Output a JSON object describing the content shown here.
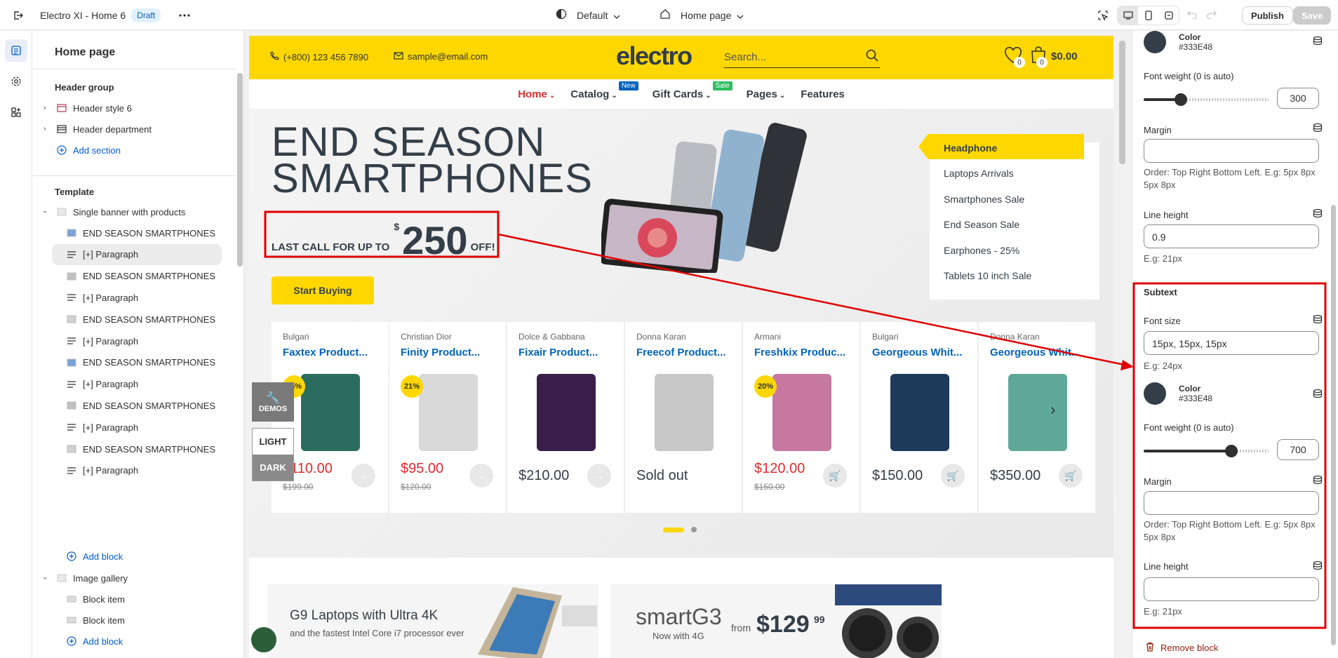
{
  "topbar": {
    "store_title": "Electro XI - Home 6",
    "status_badge": "Draft",
    "theme_label": "Default",
    "page_label": "Home page",
    "publish_label": "Publish",
    "save_label": "Save"
  },
  "sidebar": {
    "title": "Home page",
    "header_group_title": "Header group",
    "header_items": [
      {
        "label": "Header style 6"
      },
      {
        "label": "Header department"
      }
    ],
    "add_section": "Add section",
    "template_title": "Template",
    "section_label": "Single banner with products",
    "blocks": [
      {
        "label": "END SEASON SMARTPHONES"
      },
      {
        "label": "[+] Paragraph"
      },
      {
        "label": "END SEASON SMARTPHONES"
      },
      {
        "label": "[+] Paragraph"
      },
      {
        "label": "END SEASON SMARTPHONES"
      },
      {
        "label": "[+] Paragraph"
      },
      {
        "label": "END SEASON SMARTPHONES"
      },
      {
        "label": "[+] Paragraph"
      },
      {
        "label": "END SEASON SMARTPHONES"
      },
      {
        "label": "[+] Paragraph"
      },
      {
        "label": "END SEASON SMARTPHONES"
      },
      {
        "label": "[+] Paragraph"
      }
    ],
    "add_block": "Add block",
    "gallery_label": "Image gallery",
    "gallery_items": [
      {
        "label": "Block item"
      },
      {
        "label": "Block item"
      }
    ],
    "add_block_2": "Add block"
  },
  "site": {
    "phone": "(+800) 123 456 7890",
    "email": "sample@email.com",
    "logo": "electro",
    "search_placeholder": "Search...",
    "wishlist_count": "0",
    "cart_count": "0",
    "cart_total": "$0.00",
    "nav": [
      {
        "label": "Home"
      },
      {
        "label": "Catalog",
        "tag": "New"
      },
      {
        "label": "Gift Cards",
        "tag": "Sale"
      },
      {
        "label": "Pages"
      },
      {
        "label": "Features"
      }
    ],
    "hero_line1": "END SEASON",
    "hero_line2": "SMARTPHONES",
    "subtext_prefix": "LAST CALL FOR UP TO",
    "subtext_currency": "$",
    "subtext_amount": "250",
    "subtext_suffix": "OFF!",
    "cta": "Start Buying",
    "menu": [
      {
        "label": "Headphone"
      },
      {
        "label": "Laptops Arrivals"
      },
      {
        "label": "Smartphones Sale"
      },
      {
        "label": "End Season Sale"
      },
      {
        "label": "Earphones - 25%"
      },
      {
        "label": "Tablets 10 inch Sale"
      }
    ],
    "products": [
      {
        "brand": "Bulgari",
        "name": "Faxtex Product...",
        "discount": "45%",
        "price": "$110.00",
        "old": "$199.00"
      },
      {
        "brand": "Christian Dior",
        "name": "Finity Product...",
        "discount": "21%",
        "price": "$95.00",
        "old": "$120.00"
      },
      {
        "brand": "Dolce & Gabbana",
        "name": "Fixair Product...",
        "discount": "",
        "price": "$210.00",
        "old": ""
      },
      {
        "brand": "Donna Karan",
        "name": "Freecof Product...",
        "discount": "",
        "price": "Sold out",
        "old": ""
      },
      {
        "brand": "Armani",
        "name": "Freshkix Produc...",
        "discount": "20%",
        "price": "$120.00",
        "old": "$150.00"
      },
      {
        "brand": "Bulgari",
        "name": "Georgeous Whit...",
        "discount": "",
        "price": "$150.00",
        "old": ""
      },
      {
        "brand": "Donna Karan",
        "name": "Georgeous Whit...",
        "discount": "",
        "price": "$350.00",
        "old": ""
      }
    ],
    "demos_label": "DEMOS",
    "light_label": "LIGHT",
    "dark_label": "DARK",
    "banner1_title": "G9 Laptops with Ultra 4K",
    "banner1_sub": "and the fastest Intel Core i7 processor ever",
    "banner2_title": "smartG3",
    "banner2_sub": "Now with 4G",
    "banner2_from": "from",
    "banner2_price": "$129",
    "banner2_cents": "99"
  },
  "settings": {
    "top_color_label": "Color",
    "top_color_value": "#333E48",
    "font_weight_label": "Font weight (0 is auto)",
    "font_weight_top": "300",
    "font_weight_top_fraction": 0.3,
    "margin_label": "Margin",
    "margin_value": "",
    "margin_hint": "Order: Top Right Bottom Left. E.g: 5px 8px 5px 8px",
    "line_height_label": "Line height",
    "line_height_value": "0.9",
    "line_height_hint": "E.g: 21px",
    "subtext_title": "Subtext",
    "font_size_label": "Font size",
    "font_size_value": "15px, 15px, 15px",
    "font_size_hint": "E.g: 24px",
    "sub_color_label": "Color",
    "sub_color_value": "#333E48",
    "sub_font_weight_label": "Font weight (0 is auto)",
    "font_weight_sub": "700",
    "font_weight_sub_fraction": 0.7,
    "sub_margin_label": "Margin",
    "sub_margin_hint": "Order: Top Right Bottom Left. E.g: 5px 8px 5px 8px",
    "sub_line_height_label": "Line height",
    "sub_line_height_hint": "E.g: 21px",
    "remove_block": "Remove block"
  },
  "colors": {
    "brand_yellow": "#fed700",
    "text_dark": "#333e48",
    "link_blue": "#0062bd",
    "price_red": "#df2c2c",
    "annotation_red": "#e00000"
  }
}
